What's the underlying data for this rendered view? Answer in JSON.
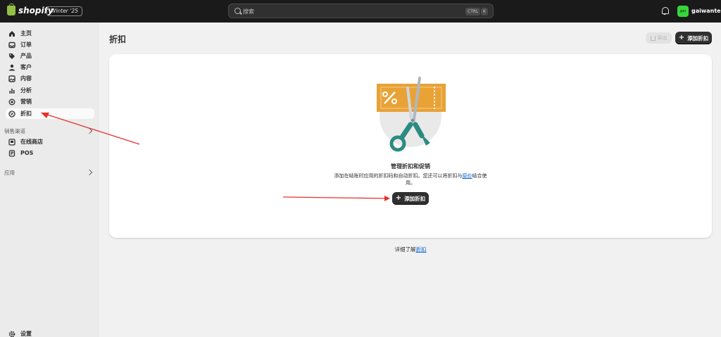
{
  "topbar": {
    "brand": "shopify",
    "edition": "Winter '25",
    "search_placeholder": "搜索",
    "kbd_ctrl": "CTRL",
    "kbd_k": "K",
    "avatar_initials": "gai",
    "username": "gaiwantea"
  },
  "sidebar": {
    "items": [
      {
        "label": "主页",
        "icon": "home-icon"
      },
      {
        "label": "订单",
        "icon": "inbox-icon"
      },
      {
        "label": "产品",
        "icon": "tag-icon"
      },
      {
        "label": "客户",
        "icon": "person-icon"
      },
      {
        "label": "内容",
        "icon": "content-icon"
      },
      {
        "label": "分析",
        "icon": "bar-chart-icon"
      },
      {
        "label": "营销",
        "icon": "target-icon"
      },
      {
        "label": "折扣",
        "icon": "discount-icon"
      }
    ],
    "sales_channels_label": "销售渠道",
    "channels": [
      {
        "label": "在线商店",
        "icon": "store-icon"
      },
      {
        "label": "POS",
        "icon": "pos-icon"
      }
    ],
    "apps_label": "应用",
    "settings_label": "设置"
  },
  "main": {
    "title": "折扣",
    "export_label": "导出",
    "add_discount_label": "添加折扣",
    "empty_title": "管理折扣和促销",
    "empty_desc_before": "添加在结账时应用的折扣码和自动折扣。您还可以将折扣与",
    "empty_desc_link": "原价",
    "empty_desc_after": "结合使用。",
    "card_add_label": "添加折扣",
    "footer_prefix": "详细了解",
    "footer_link": "折扣"
  },
  "colors": {
    "topbar": "#1a1a1a",
    "accent_green": "#95bf47",
    "avatar": "#36d63b",
    "primary_button": "#303030",
    "link": "#005bd3",
    "annotation_arrow": "#e8312a"
  }
}
